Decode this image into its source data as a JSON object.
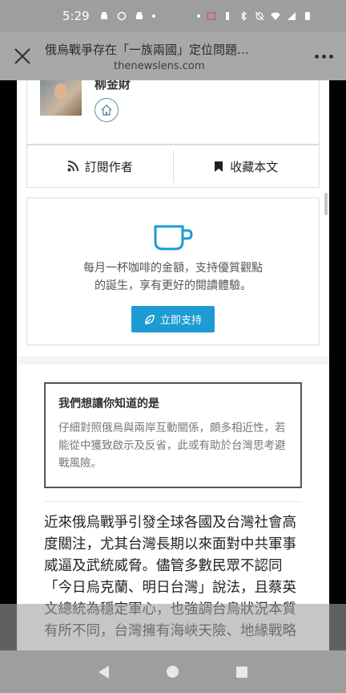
{
  "status_bar": {
    "time": "5:29"
  },
  "browser": {
    "page_title": "俄烏戰爭存在「一族兩國」定位問題，台…",
    "url": "thenewslens.com"
  },
  "author": {
    "name": "柳金財"
  },
  "actions": {
    "subscribe_label": "訂閱作者",
    "bookmark_label": "收藏本文"
  },
  "support": {
    "text_line1": "每月一杯咖啡的金額，支持優質觀點",
    "text_line2": "的誕生，享有更好的閱讀體驗。",
    "button_label": "立即支持"
  },
  "know": {
    "title": "我們想讓你知道的是",
    "body": "仔細對照俄烏與兩岸互動關係，頗多相近性，若能從中獲致啟示及反省，此或有助於台灣思考避戰風險。"
  },
  "article": {
    "body": "近來俄烏戰爭引發全球各國及台灣社會高度關注，尤其台灣長期以來面對中共軍事威逼及武統威脅。儘管多數民眾不認同「今日烏克蘭、明日台灣」說法，且蔡英文總統為穩定軍心，也強調台烏狀況本質有所不同，台灣擁有海峽天險、地緣戰略"
  },
  "colors": {
    "accent": "#1d9bd4",
    "status_bar": "#9e9e9e",
    "browser_header": "#a8a8a8"
  },
  "icons": [
    "close-icon",
    "more-icon",
    "home-icon",
    "rss-icon",
    "bookmark-icon",
    "coffee-cup-icon",
    "leaf-icon",
    "back-icon",
    "home-nav-icon",
    "recents-icon"
  ]
}
